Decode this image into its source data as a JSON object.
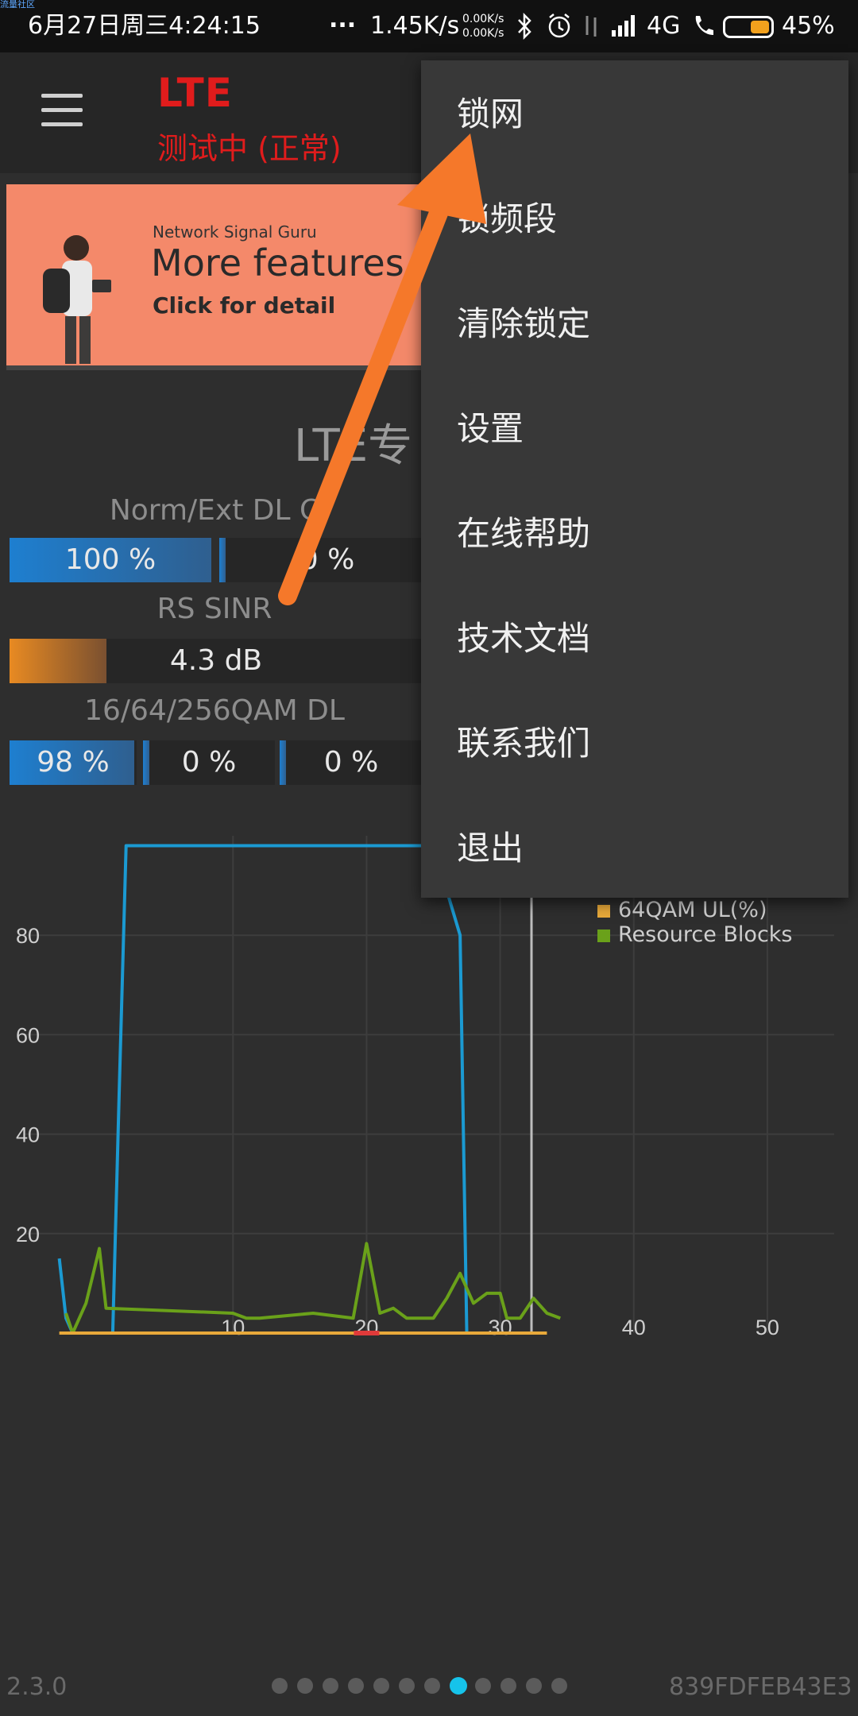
{
  "status_bar": {
    "corner_tag": "流量社区",
    "datetime": "6月27日周三4:24:15",
    "dots": "...",
    "speed": "1.45K/s",
    "up_speed": "0.00K/s",
    "down_speed": "0.00K/s",
    "network": "4G",
    "battery": "45%",
    "battery_level": 0.45,
    "icons": [
      "bluetooth-icon",
      "alarm-icon",
      "data-icon",
      "signal-icon",
      "call-icon",
      "battery-icon"
    ]
  },
  "app_bar": {
    "title": "LTE",
    "subtitle": "测试中 (正常)"
  },
  "banner": {
    "small_text": "Network Signal Guru",
    "big_text": "More features f",
    "cta": "Click for detail"
  },
  "section": {
    "title": "LTE专",
    "label_cqi": "Norm/Ext DL C",
    "cqi_norm": "100 %",
    "cqi_norm_fill": 1.0,
    "cqi_ext": "0 %",
    "label_sinr": "RS SINR",
    "sinr_value": "4.3 dB",
    "label_qam": "16/64/256QAM DL",
    "qam16": "98 %",
    "qam16_fill": 0.98,
    "qam64": "0 %",
    "qam256": "0 %"
  },
  "chart_data": {
    "type": "line",
    "y_ticks": [
      "20",
      "40",
      "60",
      "80"
    ],
    "x_ticks": [
      "10",
      "20",
      "30",
      "40",
      "50"
    ],
    "xlim": [
      -5,
      55
    ],
    "ylim": [
      0,
      100
    ],
    "legend": [
      {
        "name": "64QAM UL(%)",
        "color": "#e8a93a"
      },
      {
        "name": "Resource Blocks",
        "color": "#6aa11a"
      }
    ],
    "series": [
      {
        "name": "",
        "color": "#1b9ad2",
        "x": [
          -3,
          -2.5,
          -2,
          -1.5,
          -1,
          0,
          1,
          1.5,
          2,
          10,
          25,
          27,
          27.5,
          28
        ],
        "y": [
          15,
          3,
          0,
          0,
          0,
          0,
          0,
          50,
          98,
          98,
          98,
          80,
          0,
          0
        ]
      },
      {
        "name": "Resource Blocks",
        "color": "#6aa11a",
        "x": [
          -2.5,
          -2,
          -1,
          0,
          0.5,
          10,
          11,
          12,
          16,
          19,
          20,
          21,
          22,
          23,
          24,
          25,
          26,
          27,
          28,
          29,
          30,
          30.5,
          31.5,
          32.5,
          33.5,
          34.5
        ],
        "y": [
          4,
          0,
          6,
          17,
          5,
          4,
          3,
          3,
          4,
          3,
          18,
          4,
          5,
          3,
          3,
          3,
          7,
          12,
          6,
          8,
          8,
          3,
          3,
          7,
          4,
          3
        ]
      },
      {
        "name": "64QAM UL(%)",
        "color": "#e8a93a",
        "x": [
          -3,
          33.5
        ],
        "y": [
          0,
          0
        ]
      }
    ],
    "markers": [
      {
        "x": 20,
        "y": 0,
        "color": "#e03a3a"
      }
    ]
  },
  "footer": {
    "version": "2.3.0",
    "device_id": "839FDFEB43E3",
    "page_count": 12,
    "active_page": 7
  },
  "menu": {
    "items": [
      "锁网",
      "锁频段",
      "清除锁定",
      "设置",
      "在线帮助",
      "技术文档",
      "联系我们",
      "退出"
    ]
  },
  "annotation": {
    "color": "#f5782a"
  }
}
